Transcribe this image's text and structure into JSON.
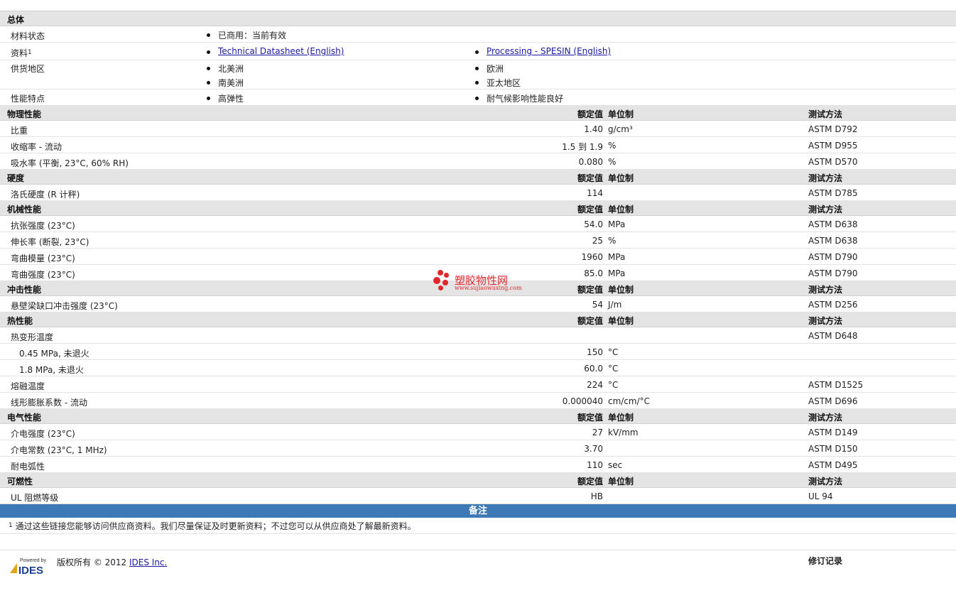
{
  "general": {
    "title": "总体",
    "material_status_label": "材料状态",
    "material_status_value": "已商用：当前有效",
    "docs_label": "资料",
    "docs_sup": "1",
    "doc_links": [
      "Technical Datasheet (English)",
      "Processing - SPESIN (English)"
    ],
    "supply_label": "供货地区",
    "supply_regions": [
      "北美洲",
      "欧洲",
      "南美洲",
      "亚太地区"
    ],
    "features_label": "性能特点",
    "features": [
      "高弹性",
      "耐气候影响性能良好"
    ]
  },
  "columns": {
    "value": "额定值",
    "unit": "单位制",
    "method": "测试方法"
  },
  "sections": [
    {
      "title": "物理性能",
      "rows": [
        {
          "label": "比重",
          "value": "1.40",
          "unit": "g/cm³",
          "method": "ASTM D792"
        },
        {
          "label": "收缩率  - 流动",
          "value": "1.5 到  1.9",
          "unit": "%",
          "method": "ASTM D955"
        },
        {
          "label": "吸水率  (平衡, 23°C, 60% RH)",
          "value": "0.080",
          "unit": "%",
          "method": "ASTM D570"
        }
      ]
    },
    {
      "title": "硬度",
      "rows": [
        {
          "label": "洛氏硬度  (R 计秤)",
          "value": "114",
          "unit": "",
          "method": "ASTM D785"
        }
      ]
    },
    {
      "title": "机械性能",
      "rows": [
        {
          "label": "抗张强度  (23°C)",
          "value": "54.0",
          "unit": "MPa",
          "method": "ASTM D638"
        },
        {
          "label": "伸长率  (断裂, 23°C)",
          "value": "25",
          "unit": "%",
          "method": "ASTM D638"
        },
        {
          "label": "弯曲模量  (23°C)",
          "value": "1960",
          "unit": "MPa",
          "method": "ASTM D790"
        },
        {
          "label": "弯曲强度  (23°C)",
          "value": "85.0",
          "unit": "MPa",
          "method": "ASTM D790"
        }
      ]
    },
    {
      "title": "冲击性能",
      "rows": [
        {
          "label": "悬壁梁缺口冲击强度  (23°C)",
          "value": "54",
          "unit": "J/m",
          "method": "ASTM D256"
        }
      ]
    },
    {
      "title": "热性能",
      "rows": [
        {
          "label": "热变形温度",
          "value": "",
          "unit": "",
          "method": "ASTM D648"
        },
        {
          "label": "0.45 MPa, 未退火",
          "value": "150",
          "unit": "°C",
          "method": "",
          "sub": true
        },
        {
          "label": "1.8 MPa, 未退火",
          "value": "60.0",
          "unit": "°C",
          "method": "",
          "sub": true
        },
        {
          "label": "熔融温度",
          "value": "224",
          "unit": "°C",
          "method": "ASTM D1525"
        },
        {
          "label": "线形膨胀系数  - 流动",
          "value": "0.000040",
          "unit": "cm/cm/°C",
          "method": "ASTM D696"
        }
      ]
    },
    {
      "title": "电气性能",
      "rows": [
        {
          "label": "介电强度  (23°C)",
          "value": "27",
          "unit": "kV/mm",
          "method": "ASTM D149"
        },
        {
          "label": "介电常数  (23°C, 1 MHz)",
          "value": "3.70",
          "unit": "",
          "method": "ASTM D150"
        },
        {
          "label": "耐电弧性",
          "value": "110",
          "unit": "sec",
          "method": "ASTM D495"
        }
      ]
    },
    {
      "title": "可燃性",
      "rows": [
        {
          "label": "UL 阻燃等级",
          "value": "HB",
          "unit": "",
          "method": "UL 94"
        }
      ]
    }
  ],
  "notes": {
    "title": "备注",
    "sup": "1",
    "text": "通过这些链接您能够访问供应商资料。我们尽量保证及时更新资料；不过您可以从供应商处了解最新资料。"
  },
  "footer": {
    "powered_by": "Powered by",
    "ides_logo": "IDES",
    "copyright": "版权所有 © 2012 ",
    "ides_link": "IDES Inc.",
    "revision": "修订记录"
  },
  "watermark": {
    "title": "塑胶物性网",
    "url": "www.sujiaowuxing.com"
  }
}
